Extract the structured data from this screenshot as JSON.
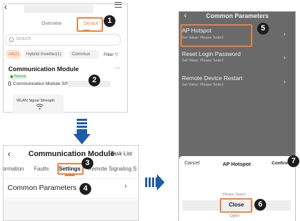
{
  "panel1": {
    "tabs": {
      "overview": "Overview",
      "device": "Device"
    },
    "search_placeholder": "Search",
    "chips": [
      "All(2)",
      "Hybrid Inverter(1)",
      "Commun"
    ],
    "filter_label": "Filter",
    "device_card": {
      "title": "Communication Module",
      "status": "Normal",
      "sn_label": "Communication Module S/N: A2",
      "wlan_label": "WLAN Signal Strength"
    }
  },
  "panel2": {
    "title": "Communication Module",
    "task_list": "Task List",
    "tabs": [
      "formation",
      "Faults",
      "Settings",
      "Remote Signaling S"
    ],
    "active_tab": "Settings",
    "row_label": "Common Parameters"
  },
  "panel3": {
    "title": "Common Parameters",
    "items": [
      {
        "title": "AP Hotspot",
        "subtitle": "Set Value: Please Select"
      },
      {
        "title": "Reset Login Password",
        "subtitle": "Set Value: Please Select"
      },
      {
        "title": "Remote Device Restart",
        "subtitle": "Set Value: Please Select"
      }
    ],
    "sheet": {
      "cancel": "Cancel",
      "title": "AP Hotspot",
      "confirm": "Confirm",
      "options": [
        "Please Select",
        "Close",
        "Open"
      ]
    }
  },
  "callouts": [
    "1",
    "2",
    "3",
    "4",
    "5",
    "6",
    "7"
  ],
  "colors": {
    "accent": "#f0803a",
    "arrow": "#1e5ca8",
    "badge": "#1d1d1d",
    "dim_overlay": "#6a6a6a"
  }
}
